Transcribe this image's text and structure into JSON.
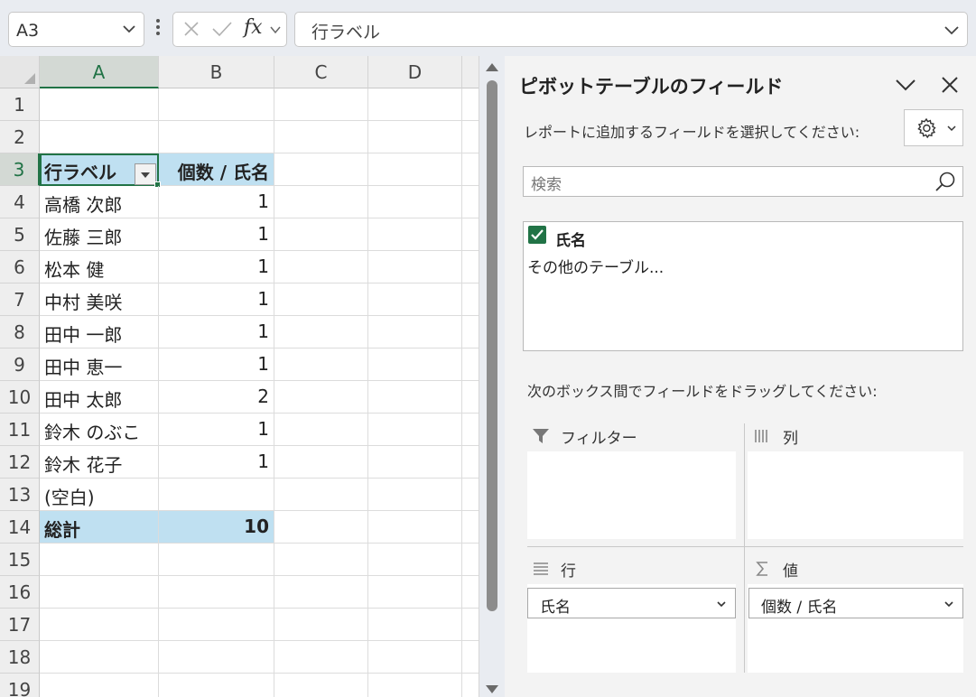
{
  "formula_bar": {
    "name_box": "A3",
    "fx_label": "fx",
    "formula": "行ラベル"
  },
  "grid": {
    "columns": [
      "A",
      "B",
      "C",
      "D"
    ],
    "rows": [
      "1",
      "2",
      "3",
      "4",
      "5",
      "6",
      "7",
      "8",
      "9",
      "10",
      "11",
      "12",
      "13",
      "14",
      "15",
      "16",
      "17",
      "18",
      "19"
    ],
    "pivot_header": {
      "row_label": "行ラベル",
      "value_label": "個数 / 氏名"
    },
    "pivot_rows": [
      {
        "name": "高橋 次郎",
        "count": "1"
      },
      {
        "name": "佐藤 三郎",
        "count": "1"
      },
      {
        "name": "松本 健",
        "count": "1"
      },
      {
        "name": "中村 美咲",
        "count": "1"
      },
      {
        "name": "田中 一郎",
        "count": "1"
      },
      {
        "name": "田中 恵一",
        "count": "1"
      },
      {
        "name": "田中 太郎",
        "count": "2"
      },
      {
        "name": "鈴木 のぶこ",
        "count": "1"
      },
      {
        "name": "鈴木 花子",
        "count": "1"
      },
      {
        "name": "(空白)",
        "count": ""
      }
    ],
    "total": {
      "label": "総計",
      "value": "10"
    }
  },
  "pane": {
    "title": "ピボットテーブルのフィールド",
    "subtitle": "レポートに追加するフィールドを選択してください:",
    "search_placeholder": "検索",
    "fields": [
      {
        "label": "氏名",
        "checked": true
      }
    ],
    "more_tables": "その他のテーブル...",
    "drag_hint": "次のボックス間でフィールドをドラッグしてください:",
    "areas": {
      "filter": "フィルター",
      "columns": "列",
      "rows": "行",
      "values": "値"
    },
    "rows_pill": "氏名",
    "values_pill": "個数 / 氏名"
  },
  "colors": {
    "accent": "#217346",
    "pivot_header_bg": "#bfe0f1"
  }
}
